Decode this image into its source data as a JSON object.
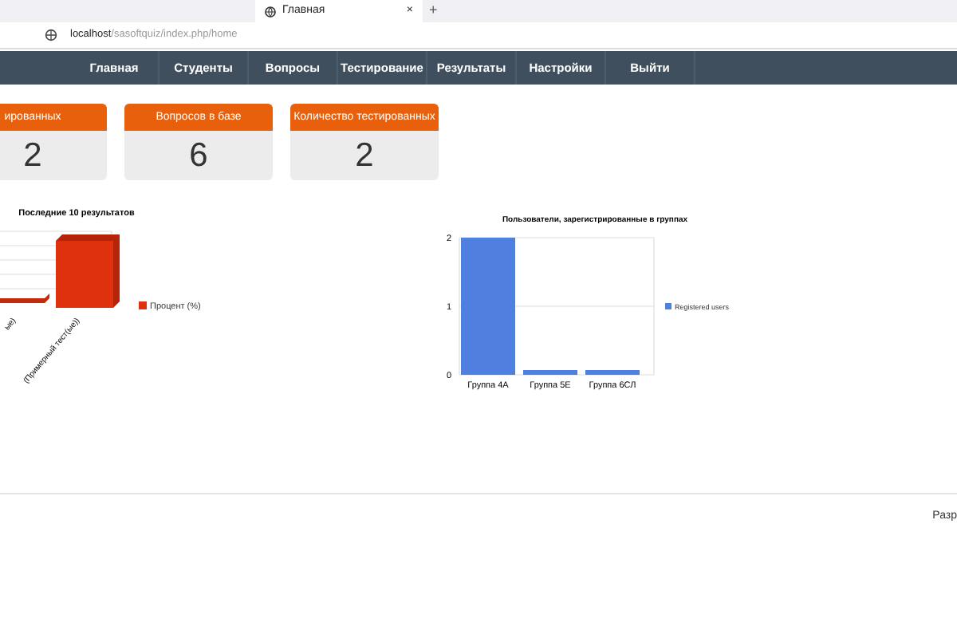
{
  "browser": {
    "tab_title": "Главная",
    "tab_close": "×",
    "new_tab": "+",
    "url_host": "localhost",
    "url_path": "/sasoftquiz/index.php/home"
  },
  "nav": [
    {
      "label": "Главная"
    },
    {
      "label": "Студенты"
    },
    {
      "label": "Вопросы"
    },
    {
      "label": "Тестирование"
    },
    {
      "label": "Результаты"
    },
    {
      "label": "Настройки"
    },
    {
      "label": "Выйти"
    }
  ],
  "stats": [
    {
      "title": "ированных",
      "value": "2"
    },
    {
      "title": "Вопросов в базе",
      "value": "6"
    },
    {
      "title": "Количество тестированных",
      "value": "2"
    }
  ],
  "results_chart": {
    "title": "Последние 10 результатов",
    "legend": "Процент (%)",
    "labels": [
      "ые)",
      "(Примерный тест(ые))"
    ]
  },
  "groups_chart": {
    "chart_data": {
      "type": "bar",
      "title": "Пользователи, зарегистрированные в группах",
      "categories": [
        "Группа 4А",
        "Группа 5Е",
        "Группа 6СЛ"
      ],
      "series": [
        {
          "name": "Registered users",
          "color": "#4f7fdf",
          "values": [
            2,
            0,
            0
          ]
        }
      ],
      "ylim": [
        0,
        2
      ],
      "yticks": [
        0,
        1,
        2
      ]
    }
  },
  "footer": {
    "text": "Разр"
  }
}
